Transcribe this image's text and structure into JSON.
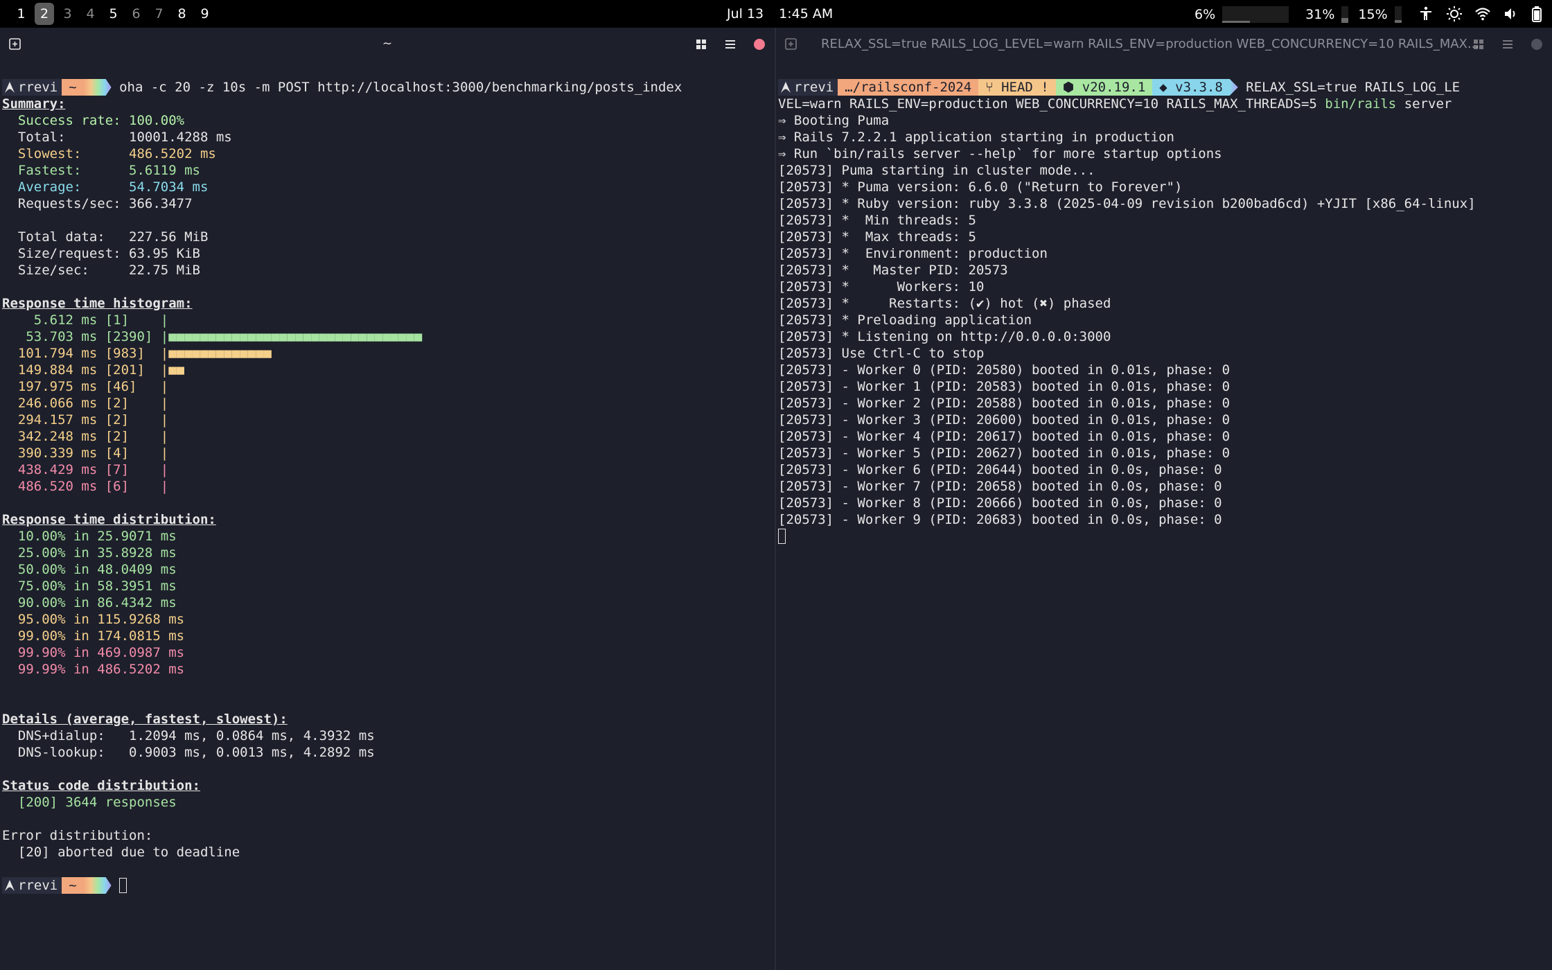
{
  "topbar": {
    "workspaces": [
      "1",
      "2",
      "3",
      "4",
      "5",
      "6",
      "7",
      "8",
      "9"
    ],
    "active_workspace": "2",
    "date": "Jul 13",
    "time": "1:45 AM",
    "cpu": "6%",
    "mem": "31%",
    "disk": "15%"
  },
  "left_pane": {
    "title": "~",
    "prompt": {
      "user": "rrevi",
      "dir": "~"
    },
    "command": "oha -c 20 -z 10s -m POST http://localhost:3000/benchmarking/posts_index",
    "summary_title": "Summary:",
    "summary": [
      {
        "label": "Success rate:",
        "value": "100.00%",
        "color": "lg"
      },
      {
        "label": "Total:",
        "value": "10001.4288 ms",
        "color": "w"
      },
      {
        "label": "Slowest:",
        "value": "486.5202 ms",
        "color": "y"
      },
      {
        "label": "Fastest:",
        "value": "5.6119 ms",
        "color": "g"
      },
      {
        "label": "Average:",
        "value": "54.7034 ms",
        "color": "c"
      },
      {
        "label": "Requests/sec:",
        "value": "366.3477",
        "color": "w"
      }
    ],
    "data_stats": [
      {
        "label": "Total data:",
        "value": "227.56 MiB"
      },
      {
        "label": "Size/request:",
        "value": "63.95 KiB"
      },
      {
        "label": "Size/sec:",
        "value": "22.75 MiB"
      }
    ],
    "histogram_title": "Response time histogram:",
    "histogram": [
      {
        "time": "5.612 ms",
        "count": "[1]",
        "bar_units": 0,
        "color": "g"
      },
      {
        "time": "53.703 ms",
        "count": "[2390]",
        "bar_units": 32,
        "color": "g"
      },
      {
        "time": "101.794 ms",
        "count": "[983]",
        "bar_units": 13,
        "color": "y"
      },
      {
        "time": "149.884 ms",
        "count": "[201]",
        "bar_units": 2,
        "color": "y"
      },
      {
        "time": "197.975 ms",
        "count": "[46]",
        "bar_units": 0,
        "color": "y"
      },
      {
        "time": "246.066 ms",
        "count": "[2]",
        "bar_units": 0,
        "color": "y"
      },
      {
        "time": "294.157 ms",
        "count": "[2]",
        "bar_units": 0,
        "color": "y"
      },
      {
        "time": "342.248 ms",
        "count": "[2]",
        "bar_units": 0,
        "color": "y"
      },
      {
        "time": "390.339 ms",
        "count": "[4]",
        "bar_units": 0,
        "color": "y"
      },
      {
        "time": "438.429 ms",
        "count": "[7]",
        "bar_units": 0,
        "color": "r"
      },
      {
        "time": "486.520 ms",
        "count": "[6]",
        "bar_units": 0,
        "color": "r"
      }
    ],
    "distribution_title": "Response time distribution:",
    "distribution": [
      {
        "text": "10.00% in 25.9071 ms",
        "color": "g"
      },
      {
        "text": "25.00% in 35.8928 ms",
        "color": "g"
      },
      {
        "text": "50.00% in 48.0409 ms",
        "color": "g"
      },
      {
        "text": "75.00% in 58.3951 ms",
        "color": "g"
      },
      {
        "text": "90.00% in 86.4342 ms",
        "color": "g"
      },
      {
        "text": "95.00% in 115.9268 ms",
        "color": "y"
      },
      {
        "text": "99.00% in 174.0815 ms",
        "color": "y"
      },
      {
        "text": "99.90% in 469.0987 ms",
        "color": "r"
      },
      {
        "text": "99.99% in 486.5202 ms",
        "color": "r"
      }
    ],
    "details_title": "Details (average, fastest, slowest):",
    "details": [
      {
        "label": "DNS+dialup:",
        "value": "1.2094 ms, 0.0864 ms, 4.3932 ms"
      },
      {
        "label": "DNS-lookup:",
        "value": "0.9003 ms, 0.0013 ms, 4.2892 ms"
      }
    ],
    "status_title": "Status code distribution:",
    "status": "[200] 3644 responses",
    "error_title": "Error distribution:",
    "error": "[20] aborted due to deadline"
  },
  "right_pane": {
    "title": "RELAX_SSL=true RAILS_LOG_LEVEL=warn RAILS_ENV=production WEB_CONCURRENCY=10 RAILS_MAX...",
    "prompt": {
      "user": "rrevi",
      "dir": "…/railsconf-2024",
      "git": "HEAD !",
      "node": "v20.19.1",
      "ruby": "v3.3.8"
    },
    "command_first": "RELAX_SSL=true RAILS_LOG_LE",
    "command_wrap": "VEL=warn RAILS_ENV=production WEB_CONCURRENCY=10 RAILS_MAX_THREADS=5 ",
    "command_bin": "bin/rails",
    "command_tail": " server",
    "lines": [
      "⇒ Booting Puma",
      "⇒ Rails 7.2.2.1 application starting in production",
      "⇒ Run `bin/rails server --help` for more startup options",
      "[20573] Puma starting in cluster mode...",
      "[20573] * Puma version: 6.6.0 (\"Return to Forever\")",
      "[20573] * Ruby version: ruby 3.3.8 (2025-04-09 revision b200bad6cd) +YJIT [x86_64-linux]",
      "[20573] *  Min threads: 5",
      "[20573] *  Max threads: 5",
      "[20573] *  Environment: production",
      "[20573] *   Master PID: 20573",
      "[20573] *      Workers: 10",
      "[20573] *     Restarts: (✔) hot (✖) phased",
      "[20573] * Preloading application",
      "[20573] * Listening on http://0.0.0.0:3000",
      "[20573] Use Ctrl-C to stop",
      "[20573] - Worker 0 (PID: 20580) booted in 0.01s, phase: 0",
      "[20573] - Worker 1 (PID: 20583) booted in 0.01s, phase: 0",
      "[20573] - Worker 2 (PID: 20588) booted in 0.01s, phase: 0",
      "[20573] - Worker 3 (PID: 20600) booted in 0.01s, phase: 0",
      "[20573] - Worker 4 (PID: 20617) booted in 0.01s, phase: 0",
      "[20573] - Worker 5 (PID: 20627) booted in 0.01s, phase: 0",
      "[20573] - Worker 6 (PID: 20644) booted in 0.0s, phase: 0",
      "[20573] - Worker 7 (PID: 20658) booted in 0.0s, phase: 0",
      "[20573] - Worker 8 (PID: 20666) booted in 0.0s, phase: 0",
      "[20573] - Worker 9 (PID: 20683) booted in 0.0s, phase: 0"
    ]
  },
  "colors": {
    "background": "#1d1f2b",
    "green": "#a6e3a1",
    "yellow": "#f5d08a",
    "cyan": "#89dceb",
    "red": "#f38ba8",
    "prompt_dir": "#f2a77c"
  }
}
